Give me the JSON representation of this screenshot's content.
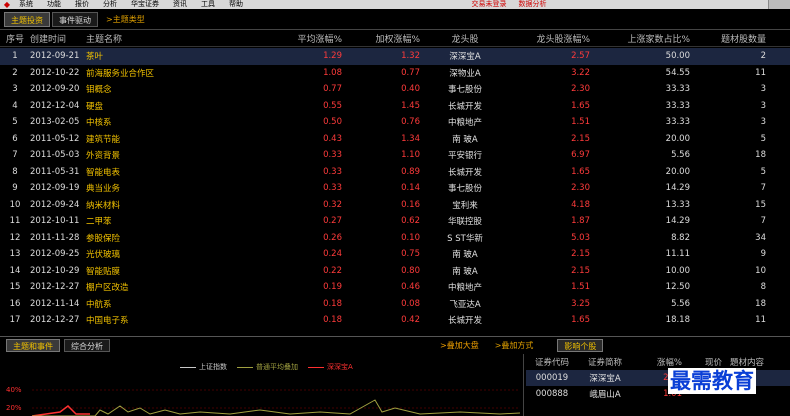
{
  "menu": {
    "items": [
      "系统",
      "功能",
      "报价",
      "分析",
      "华宝证券",
      "资讯",
      "工具",
      "帮助"
    ],
    "links": [
      "交易未登录",
      "数据分析"
    ]
  },
  "tabs": {
    "main_invest": "主题投资",
    "event_driven": "事件驱动",
    "type_link": ">主题类型"
  },
  "table": {
    "headers": [
      "序号",
      "创建时间",
      "主题名称",
      "平均涨幅%",
      "加权涨幅%",
      "龙头股",
      "龙头股涨幅%",
      "上涨家数占比%",
      "题材股数量"
    ],
    "rows": [
      [
        "1",
        "2012-09-21",
        "茶叶",
        "1.29",
        "1.32",
        "深深宝A",
        "2.57",
        "50.00",
        "2"
      ],
      [
        "2",
        "2012-10-22",
        "前海服务业合作区",
        "1.08",
        "0.77",
        "深物业A",
        "3.22",
        "54.55",
        "11"
      ],
      [
        "3",
        "2012-09-20",
        "钼概念",
        "0.77",
        "0.40",
        "事七股份",
        "2.30",
        "33.33",
        "3"
      ],
      [
        "4",
        "2012-12-04",
        "硬盘",
        "0.55",
        "1.45",
        "长城开发",
        "1.65",
        "33.33",
        "3"
      ],
      [
        "5",
        "2013-02-05",
        "中核系",
        "0.50",
        "0.76",
        "中粮地产",
        "1.51",
        "33.33",
        "3"
      ],
      [
        "6",
        "2011-05-12",
        "建筑节能",
        "0.43",
        "1.34",
        "南 玻A",
        "2.15",
        "20.00",
        "5"
      ],
      [
        "7",
        "2011-05-03",
        "外资背景",
        "0.33",
        "1.10",
        "平安银行",
        "6.97",
        "5.56",
        "18"
      ],
      [
        "8",
        "2011-05-31",
        "智能电表",
        "0.33",
        "0.89",
        "长城开发",
        "1.65",
        "20.00",
        "5"
      ],
      [
        "9",
        "2012-09-19",
        "典当业务",
        "0.33",
        "0.14",
        "事七股份",
        "2.30",
        "14.29",
        "7"
      ],
      [
        "10",
        "2012-09-24",
        "纳米材料",
        "0.32",
        "0.16",
        "宝利来",
        "4.18",
        "13.33",
        "15"
      ],
      [
        "11",
        "2012-10-11",
        "二甲苯",
        "0.27",
        "0.62",
        "华联控股",
        "1.87",
        "14.29",
        "7"
      ],
      [
        "12",
        "2011-11-28",
        "参股保险",
        "0.26",
        "0.10",
        "S ST华新",
        "5.03",
        "8.82",
        "34"
      ],
      [
        "13",
        "2012-09-25",
        "光伏玻璃",
        "0.24",
        "0.75",
        "南 玻A",
        "2.15",
        "11.11",
        "9"
      ],
      [
        "14",
        "2012-10-29",
        "智能贴膜",
        "0.22",
        "0.80",
        "南 玻A",
        "2.15",
        "10.00",
        "10"
      ],
      [
        "15",
        "2012-12-27",
        "棚户区改造",
        "0.19",
        "0.46",
        "中粮地产",
        "1.51",
        "12.50",
        "8"
      ],
      [
        "16",
        "2012-11-14",
        "中航系",
        "0.18",
        "0.08",
        "飞亚达A",
        "3.25",
        "5.56",
        "18"
      ],
      [
        "17",
        "2012-12-27",
        "中国电子系",
        "0.18",
        "0.42",
        "长城开发",
        "1.65",
        "18.18",
        "11"
      ]
    ]
  },
  "lower_tabs": {
    "events": "主题和事件",
    "analysis": "综合分析",
    "add_market": ">叠加大盘",
    "add_mode": ">叠加方式",
    "related": "影响个股"
  },
  "chart": {
    "legend": [
      "上证指数",
      "普通平均叠加",
      "深深宝A"
    ],
    "legend_colors": [
      "#c8c8c8",
      "#a0a040",
      "#ff3030"
    ],
    "y_ticks": [
      "40%",
      "20%"
    ]
  },
  "stock_panel": {
    "headers": [
      "证券代码",
      "证券简称",
      "涨幅%",
      "现价",
      "題材内容"
    ],
    "rows": [
      [
        "000019",
        "深深宝A",
        "2.57"
      ],
      [
        "000888",
        "峨眉山A",
        "1.01"
      ]
    ]
  },
  "watermark": "最需教育"
}
